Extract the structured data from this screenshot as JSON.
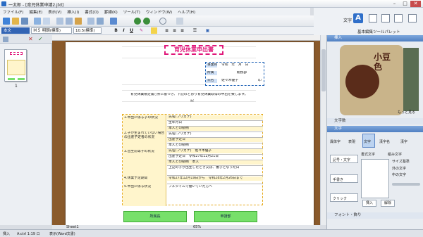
{
  "window": {
    "title": "一太郎 - [育児休業申請2.jtd]",
    "min": "–",
    "max": "□",
    "close": "✕"
  },
  "menu": [
    "ファイル(F)",
    "編集(E)",
    "表示(V)",
    "挿入(I)",
    "書式(O)",
    "罫線(K)",
    "ツール(T)",
    "ウィンドウ(W)",
    "ヘルプ(H)"
  ],
  "toolbar_right": {
    "text_label": "文字",
    "panel_label": "基本編集ツールパレット"
  },
  "format": {
    "style": "本文",
    "font": "ＭＳ 明朝(標準)",
    "size": "10.5(標準)",
    "bold": "B",
    "italic": "I",
    "underline": "U"
  },
  "thumbnail": {
    "page_number": "1"
  },
  "document": {
    "title": "育児休業申出書",
    "date": "令和　年　月　日",
    "row_head": "事業所",
    "address_label": "所属",
    "address_value": "総務部",
    "name_label": "氏名",
    "name_value": "佐々木優子",
    "seal": "印",
    "body_text": "育児休業規定第○条に基づき、下記のとおり育児休業取得の申出を致します。",
    "record": "記",
    "left_labels": [
      "1.申出に係る子の状況",
      "2.子が生まれていない場合の出産予定者の状況",
      "3.出生前等子の状況",
      "4.休業予定期間",
      "5.申出に係る状況"
    ],
    "right_rows": [
      "氏名(フリガナ)",
      "生年月日",
      "本人との続柄",
      "氏名(フリガナ)",
      "出産予定日",
      "本人との続柄",
      "氏名(フリガナ)　佐々木優子",
      "出産予定日　令和27年12月21日",
      "本人との続柄　本人",
      "上記の子が出生したとき又は、養子となった日",
      "令和27年12月19日から　令和28年2月26日まで",
      "フルタイムで働いていた方へ"
    ],
    "green_left": "所属長",
    "green_right": "申請部"
  },
  "right_panel": {
    "section1": "挿入",
    "image_text": "小豆色",
    "more": "もっと見る",
    "section2": "文字数",
    "section3": "文字",
    "tools": [
      "異体字",
      "表現",
      "文字",
      "漢字名",
      "漢字"
    ],
    "side_buttons": [
      "記号・文字",
      "手書き",
      "クリック"
    ],
    "list_title": "書式文字",
    "list_title2": "組み文字",
    "option_label": "サイズ基準",
    "option1": "外の文字",
    "option2": "中の文字",
    "btn_insert": "挿入",
    "btn_cancel": "解除",
    "footer": "フォント・飾り"
  },
  "sheet": {
    "tab": "Sheet1",
    "zoom": "65%"
  },
  "status": {
    "mode": "挿入",
    "info": "A:ctrl 1:19  ロ",
    "mid": "表示(Word文書)"
  }
}
